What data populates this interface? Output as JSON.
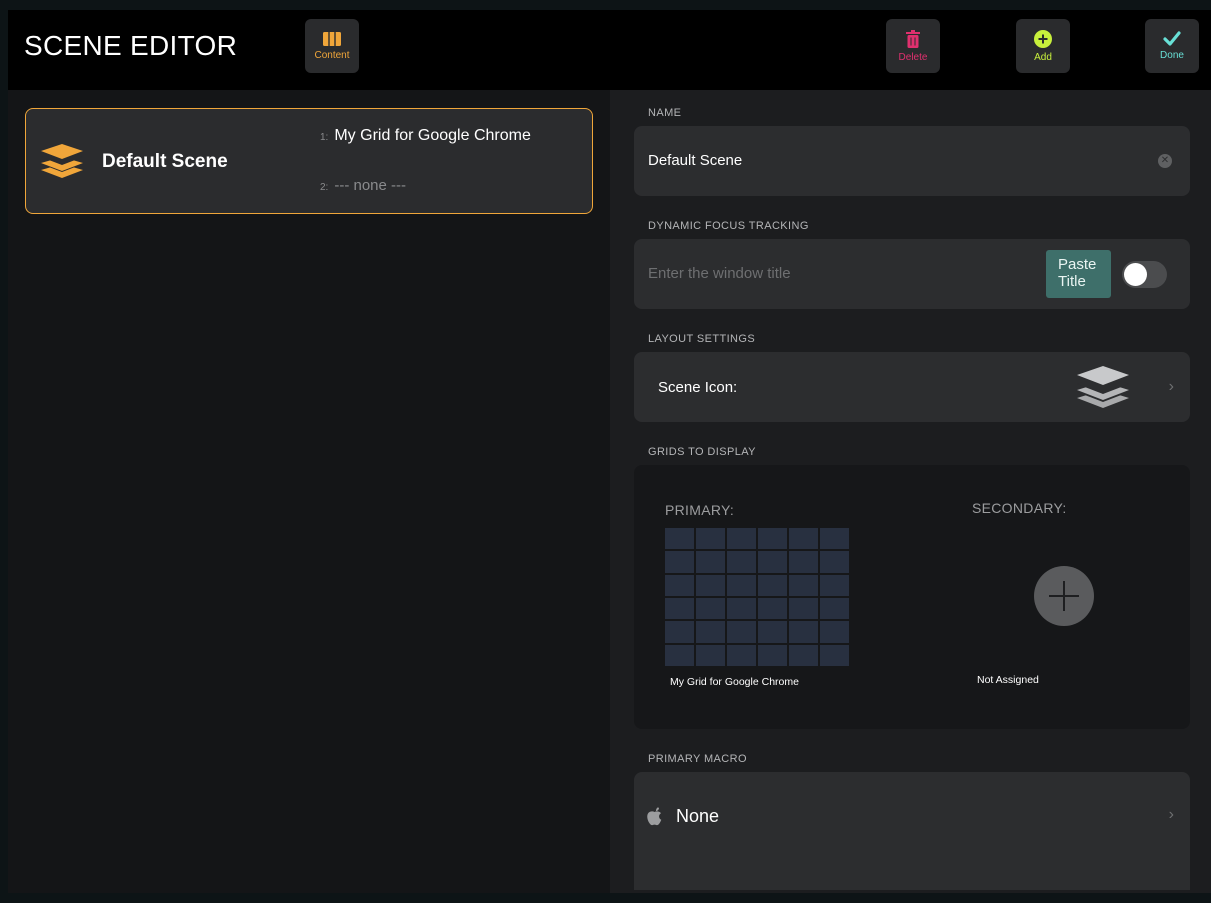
{
  "header": {
    "title": "SCENE EDITOR",
    "buttons": {
      "content": "Content",
      "delete": "Delete",
      "add": "Add",
      "done": "Done"
    }
  },
  "scenes": [
    {
      "name": "Default Scene",
      "grid1_num": "1:",
      "grid1": "My Grid for Google Chrome",
      "grid2_num": "2:",
      "grid2": "--- none ---"
    }
  ],
  "form": {
    "name_label": "NAME",
    "name_value": "Default Scene",
    "focus_label": "DYNAMIC FOCUS TRACKING",
    "focus_placeholder": "Enter the window title",
    "paste_line1": "Paste",
    "paste_line2": "Title",
    "focus_tracking_enabled": false,
    "layout_label": "LAYOUT SETTINGS",
    "scene_icon_label": "Scene Icon:",
    "grids_label": "GRIDS TO DISPLAY",
    "primary_label": "PRIMARY:",
    "secondary_label": "SECONDARY:",
    "primary_grid": "My Grid for Google Chrome",
    "secondary_grid": "Not Assigned",
    "macro_label": "PRIMARY MACRO",
    "macro_value": "None"
  },
  "colors": {
    "accent_orange": "#f0a63a",
    "delete_pink": "#e0306e",
    "add_green": "#c8f03c",
    "done_teal": "#68e0d6",
    "paste_teal": "#3e6f6a"
  },
  "icons": {
    "content": "content-icon",
    "delete": "trash-icon",
    "add": "plus-circle-icon",
    "done": "checkmark-icon",
    "scene": "layers-stack-icon",
    "macro": "apple-icon"
  }
}
